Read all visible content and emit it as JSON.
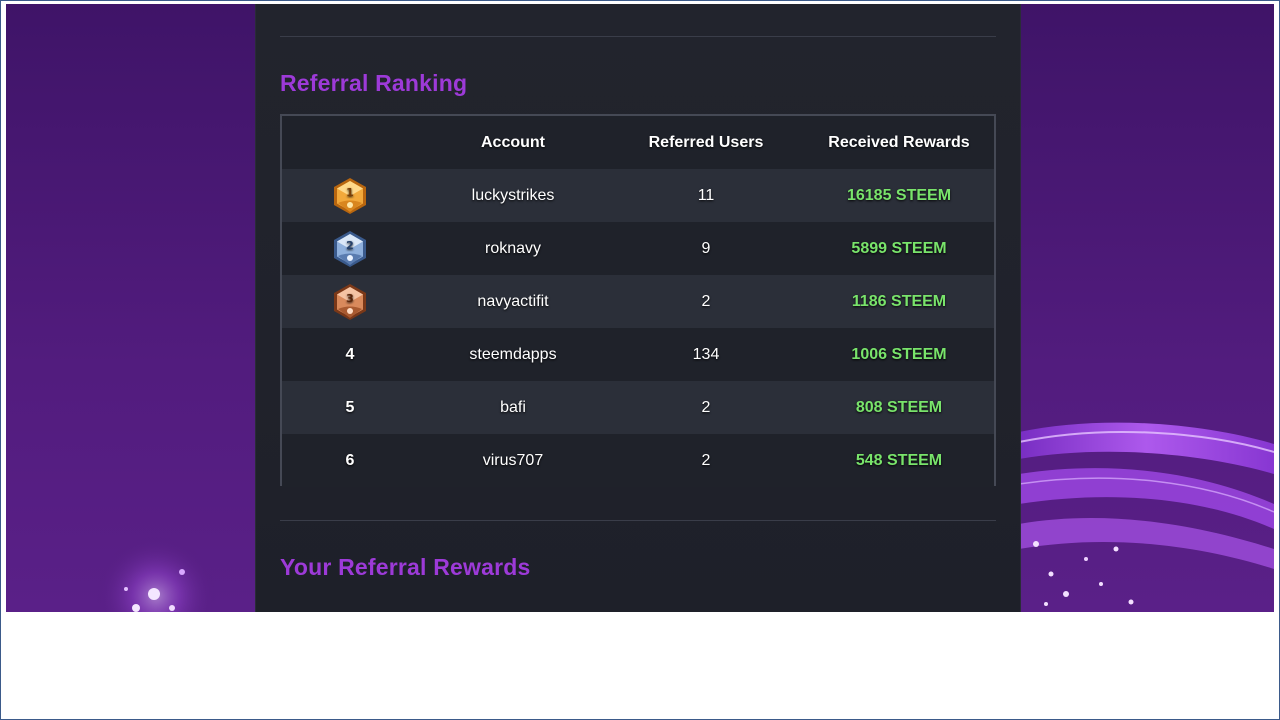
{
  "sections": {
    "ranking_title": "Referral Ranking",
    "rewards_title": "Your Referral Rewards"
  },
  "table": {
    "headers": {
      "rank": "",
      "account": "Account",
      "referred": "Referred Users",
      "rewards": "Received Rewards"
    },
    "rows": [
      {
        "rank": "1",
        "medal": "gold-medal-icon",
        "account": "luckystrikes",
        "referred": "11",
        "rewards": "16185 STEEM"
      },
      {
        "rank": "2",
        "medal": "silver-medal-icon",
        "account": "roknavy",
        "referred": "9",
        "rewards": "5899 STEEM"
      },
      {
        "rank": "3",
        "medal": "bronze-medal-icon",
        "account": "navyactifit",
        "referred": "2",
        "rewards": "1186 STEEM"
      },
      {
        "rank": "4",
        "account": "steemdapps",
        "referred": "134",
        "rewards": "1006 STEEM"
      },
      {
        "rank": "5",
        "account": "bafi",
        "referred": "2",
        "rewards": "808 STEEM"
      },
      {
        "rank": "6",
        "account": "virus707",
        "referred": "2",
        "rewards": "548 STEEM"
      }
    ]
  },
  "colors": {
    "title": "#9d3ad8",
    "reward": "#79e46b",
    "background": "#4a1a73",
    "panel": "#22242d"
  }
}
